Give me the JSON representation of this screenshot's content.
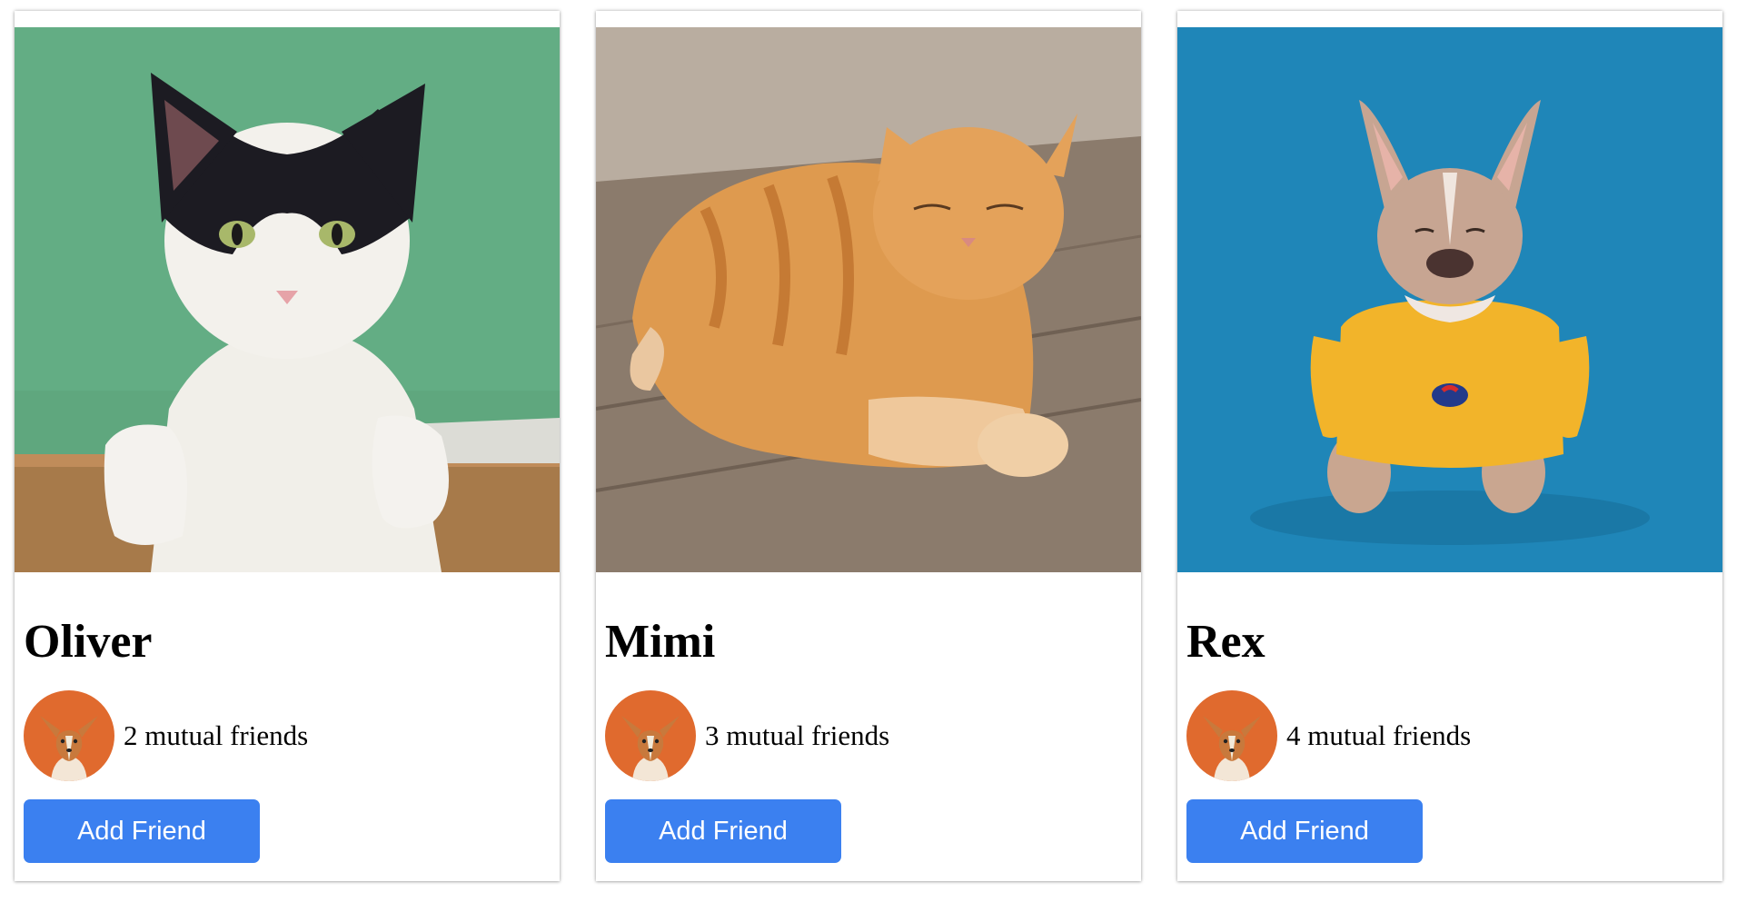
{
  "cards": [
    {
      "name": "Oliver",
      "photo_icon": "black-white-cat-photo",
      "avatar_icon": "corgi-puppy-avatar",
      "mutual": "2 mutual friends",
      "button": "Add Friend"
    },
    {
      "name": "Mimi",
      "photo_icon": "orange-tabby-cat-photo",
      "avatar_icon": "corgi-puppy-avatar",
      "mutual": "3 mutual friends",
      "button": "Add Friend"
    },
    {
      "name": "Rex",
      "photo_icon": "french-bulldog-photo",
      "avatar_icon": "corgi-puppy-avatar",
      "mutual": "4 mutual friends",
      "button": "Add Friend"
    }
  ],
  "colors": {
    "button_bg": "#3b80f0",
    "button_text": "#ffffff",
    "photo1_bg": "#5fa77e",
    "photo2_bg": "#8a7a6a",
    "photo3_bg": "#1f86b8",
    "avatar_bg": "#e06a2e"
  }
}
